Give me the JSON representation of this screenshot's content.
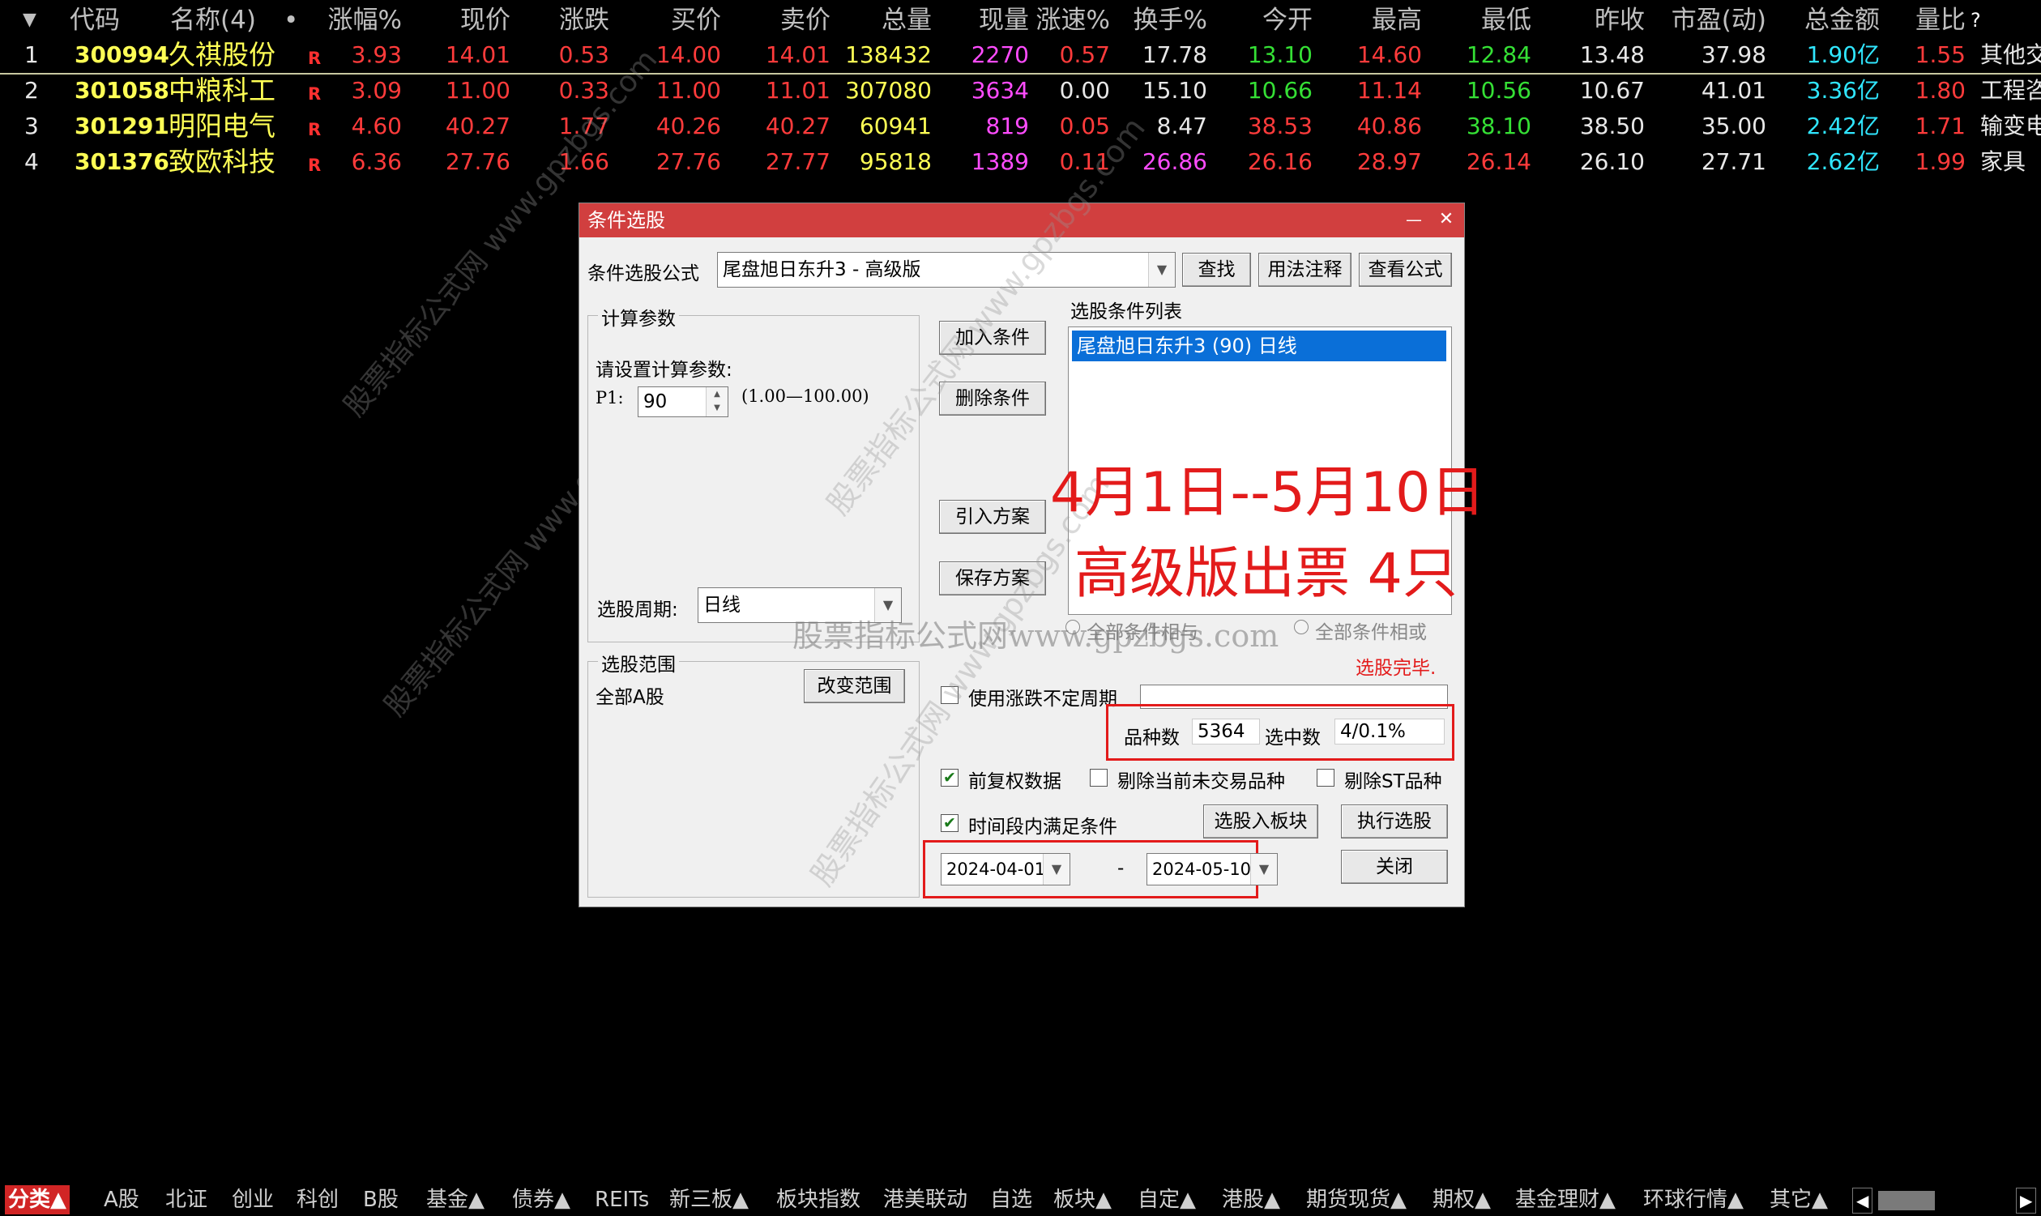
{
  "table": {
    "headers": [
      {
        "id": "code",
        "label": "代码"
      },
      {
        "id": "name",
        "label": "名称(4)"
      },
      {
        "id": "dot",
        "label": "•"
      },
      {
        "id": "chg_pct",
        "label": "涨幅%"
      },
      {
        "id": "price",
        "label": "现价"
      },
      {
        "id": "chg",
        "label": "涨跌"
      },
      {
        "id": "bid",
        "label": "买价"
      },
      {
        "id": "ask",
        "label": "卖价"
      },
      {
        "id": "vol",
        "label": "总量"
      },
      {
        "id": "cur_vol",
        "label": "现量"
      },
      {
        "id": "speed",
        "label": "涨速%"
      },
      {
        "id": "turnover",
        "label": "换手%"
      },
      {
        "id": "open",
        "label": "今开"
      },
      {
        "id": "high",
        "label": "最高"
      },
      {
        "id": "low",
        "label": "最低"
      },
      {
        "id": "prev_close",
        "label": "昨收"
      },
      {
        "id": "pe",
        "label": "市盈(动)"
      },
      {
        "id": "amount",
        "label": "总金额"
      },
      {
        "id": "vol_ratio",
        "label": "量比"
      },
      {
        "id": "help",
        "label": "?"
      }
    ],
    "rows": [
      {
        "idx": "1",
        "code": "300994",
        "name": "久祺股份",
        "flag": "R",
        "chg_pct": "3.93",
        "price": "14.01",
        "chg": "0.53",
        "bid": "14.00",
        "ask": "14.01",
        "vol": "138432",
        "cur_vol": "2270",
        "speed": "0.57",
        "turnover": "17.78",
        "open": "13.10",
        "high": "14.60",
        "low": "12.84",
        "prev_close": "13.48",
        "pe": "37.98",
        "amount": "1.90亿",
        "vol_ratio": "1.55",
        "industry": "其他交"
      },
      {
        "idx": "2",
        "code": "301058",
        "name": "中粮科工",
        "flag": "R",
        "chg_pct": "3.09",
        "price": "11.00",
        "chg": "0.33",
        "bid": "11.00",
        "ask": "11.01",
        "vol": "307080",
        "cur_vol": "3634",
        "speed": "0.00",
        "turnover": "15.10",
        "open": "10.66",
        "high": "11.14",
        "low": "10.56",
        "prev_close": "10.67",
        "pe": "41.01",
        "amount": "3.36亿",
        "vol_ratio": "1.80",
        "industry": "工程咨"
      },
      {
        "idx": "3",
        "code": "301291",
        "name": "明阳电气",
        "flag": "R",
        "chg_pct": "4.60",
        "price": "40.27",
        "chg": "1.77",
        "bid": "40.26",
        "ask": "40.27",
        "vol": "60941",
        "cur_vol": "819",
        "speed": "0.05",
        "turnover": "8.47",
        "open": "38.53",
        "high": "40.86",
        "low": "38.10",
        "prev_close": "38.50",
        "pe": "35.00",
        "amount": "2.42亿",
        "vol_ratio": "1.71",
        "industry": "输变电"
      },
      {
        "idx": "4",
        "code": "301376",
        "name": "致欧科技",
        "flag": "R",
        "chg_pct": "6.36",
        "price": "27.76",
        "chg": "1.66",
        "bid": "27.76",
        "ask": "27.77",
        "vol": "95818",
        "cur_vol": "1389",
        "speed": "0.11",
        "turnover": "26.86",
        "open": "26.16",
        "high": "28.97",
        "low": "26.14",
        "prev_close": "26.10",
        "pe": "27.71",
        "amount": "2.62亿",
        "vol_ratio": "1.99",
        "industry": "家具"
      }
    ]
  },
  "dialog": {
    "title": "条件选股",
    "minimize": "—",
    "close": "✕",
    "formula_label": "条件选股公式",
    "formula_value": "尾盘旭日东升3 - 高级版",
    "btn_find": "查找",
    "btn_usage": "用法注释",
    "btn_view": "查看公式",
    "params_group": "计算参数",
    "params_prompt": "请设置计算参数:",
    "p1_label": "P1:",
    "p1_value": "90",
    "p1_range": "(1.00—100.00)",
    "btn_add": "加入条件",
    "btn_delete": "删除条件",
    "btn_import": "引入方案",
    "btn_save": "保存方案",
    "cond_list_label": "选股条件列表",
    "cond_items": [
      "尾盘旭日东升3 (90) 日线"
    ],
    "period_label": "选股周期:",
    "period_value": "日线",
    "radio_and": "全部条件相与",
    "radio_or": "全部条件相或",
    "status": "选股完毕.",
    "scope_group": "选股范围",
    "scope_value": "全部A股",
    "btn_change_scope": "改变范围",
    "cb_uncertain_period": "使用涨跌不定周期",
    "count_label": "品种数",
    "count_value": "5364",
    "selected_label": "选中数",
    "selected_value": "4/0.1%",
    "cb_forward_adjust": "前复权数据",
    "cb_exclude_notrade": "剔除当前未交易品种",
    "cb_exclude_st": "剔除ST品种",
    "cb_time_range": "时间段内满足条件",
    "btn_to_block": "选股入板块",
    "btn_execute": "执行选股",
    "date_from": "2024-04-01",
    "date_sep": "-",
    "date_to": "2024-05-10",
    "btn_close": "关闭"
  },
  "overlay": {
    "line1": "4月1日--5月10日",
    "line2": "高级版出票 4只",
    "watermark_center": "股票指标公式网www.gpzbgs.com",
    "watermark_small": "股票指标公式网 www.gpzbgs.com"
  },
  "tabs": [
    {
      "label": "分类▲",
      "active": true
    },
    {
      "label": "A股"
    },
    {
      "label": "北证"
    },
    {
      "label": "创业"
    },
    {
      "label": "科创"
    },
    {
      "label": "B股"
    },
    {
      "label": "基金▲"
    },
    {
      "label": "债券▲"
    },
    {
      "label": "REITs"
    },
    {
      "label": "新三板▲"
    },
    {
      "label": "板块指数"
    },
    {
      "label": "港美联动"
    },
    {
      "label": "自选"
    },
    {
      "label": "板块▲"
    },
    {
      "label": "自定▲"
    },
    {
      "label": "港股▲"
    },
    {
      "label": "期货现货▲"
    },
    {
      "label": "期权▲"
    },
    {
      "label": "基金理财▲"
    },
    {
      "label": "环球行情▲"
    },
    {
      "label": "其它▲"
    }
  ],
  "colors": {
    "accent_red": "#e31b1b",
    "title_red": "#d13f3f",
    "selected_blue": "#0a6fd8"
  }
}
